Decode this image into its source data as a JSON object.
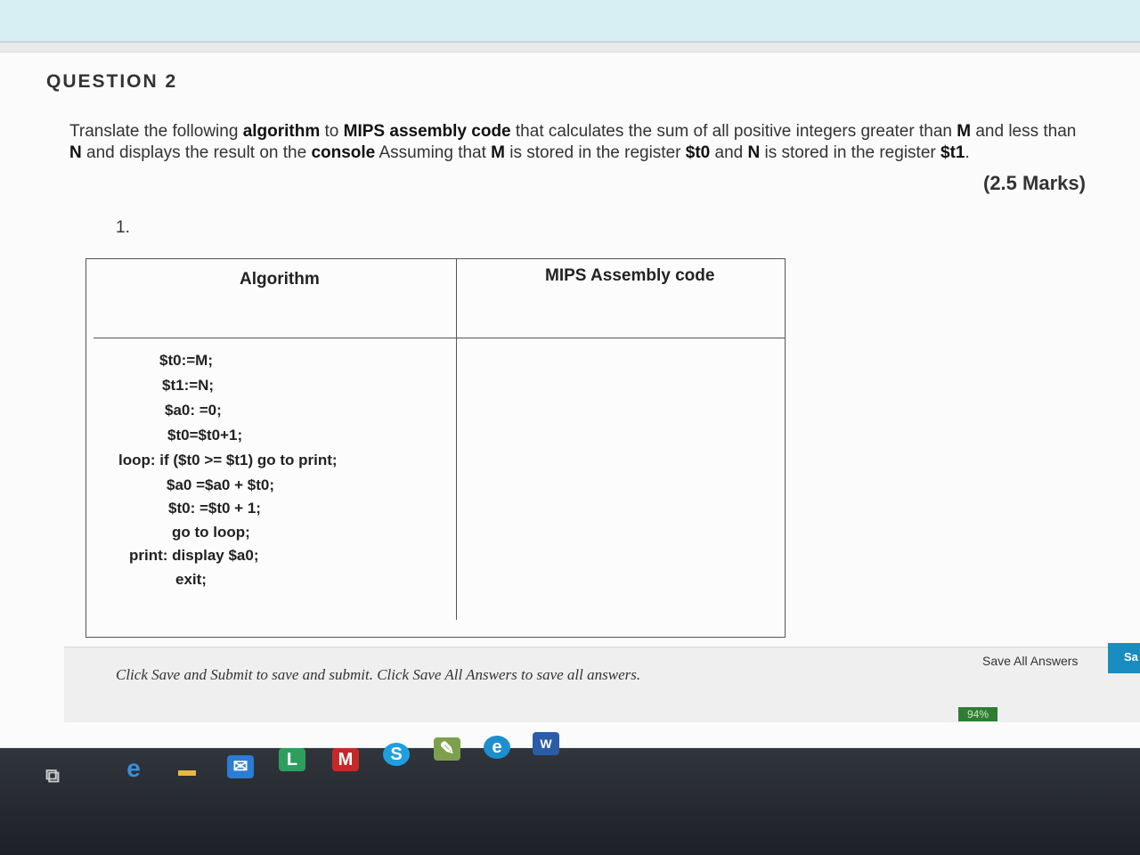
{
  "question": {
    "header": "QUESTION 2",
    "line1_parts": [
      {
        "t": "Translate the following ",
        "b": false
      },
      {
        "t": "algorithm",
        "b": true
      },
      {
        "t": "  to ",
        "b": false
      },
      {
        "t": "MIPS assembly code",
        "b": true
      },
      {
        "t": " that calculates the sum  of all positive integers greater than ",
        "b": false
      },
      {
        "t": "M",
        "b": true
      },
      {
        "t": " and less than",
        "b": false
      }
    ],
    "line2_parts": [
      {
        "t": "N",
        "b": true
      },
      {
        "t": " and displays the result on the ",
        "b": false
      },
      {
        "t": "console",
        "b": true
      },
      {
        "t": " Assuming that ",
        "b": false
      },
      {
        "t": "M",
        "b": true
      },
      {
        "t": " is  stored in the register ",
        "b": false
      },
      {
        "t": "$t0",
        "b": true
      },
      {
        "t": " and ",
        "b": false
      },
      {
        "t": "N",
        "b": true
      },
      {
        "t": " is  stored in the register ",
        "b": false
      },
      {
        "t": "$t1",
        "b": true
      },
      {
        "t": ".",
        "b": false
      }
    ],
    "marks": "(2.5 Marks)",
    "number": "1."
  },
  "table": {
    "col1_header": "Algorithm",
    "col2_header": "MIPS Assembly code",
    "algorithm_lines": [
      "$t0:=M;",
      "$t1:=N;",
      "$a0: =0;",
      "$t0=$t0+1;",
      "loop:  if ($t0 >= $t1) go to print;",
      "$a0 =$a0 + $t0;",
      "$t0: =$t0 + 1;",
      "go to loop;",
      "print:  display $a0;",
      "exit;"
    ]
  },
  "footer": {
    "instructions": "Click Save and Submit to save and submit. Click Save All Answers to save all answers.",
    "save_all_label": "Save All Answers",
    "save_submit_label": "Sa"
  },
  "system": {
    "battery": "94%"
  },
  "taskbar_icons": [
    "edge-legacy-icon",
    "file-explorer-icon",
    "mail-icon",
    "l-app-icon",
    "mcafee-icon",
    "skype-icon",
    "photo-app-icon",
    "edge-icon",
    "word-icon"
  ]
}
